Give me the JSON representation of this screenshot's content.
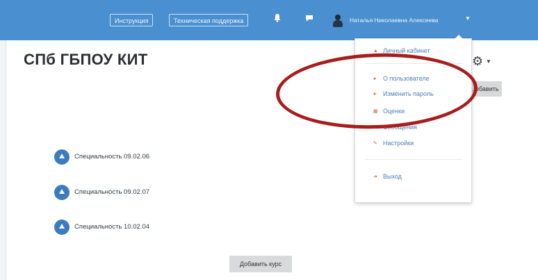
{
  "topbar": {
    "buttons": [
      "Инструкция",
      "Техническая поддержка"
    ],
    "bell_icon": "bell-icon",
    "chat_icon": "chat-icon",
    "user_name": "Наталья Николаевна Алексеева",
    "accent": "#4a8fcf"
  },
  "site": {
    "title": "СПб ГБПОУ КИТ",
    "grey_button": "...обавить"
  },
  "categories": [
    "Специальность 09.02.06",
    "Специальность 09.02.07",
    "Специальность 10.02.04"
  ],
  "add_course": "Добавить курс",
  "user_menu": {
    "items": [
      {
        "label": "Личный кабинет",
        "icon": "dashboard-icon"
      },
      {
        "label": "О пользователе",
        "icon": "user-icon"
      },
      {
        "label": "Изменить пароль",
        "icon": "key-icon"
      },
      {
        "label": "Оценки",
        "icon": "grades-icon"
      },
      {
        "label": "Сообщения",
        "icon": "messages-icon"
      },
      {
        "label": "Настройки",
        "icon": "wrench-icon"
      },
      {
        "label": "Выход",
        "icon": "logout-icon"
      }
    ]
  },
  "annotation_color": "#a81c1c"
}
